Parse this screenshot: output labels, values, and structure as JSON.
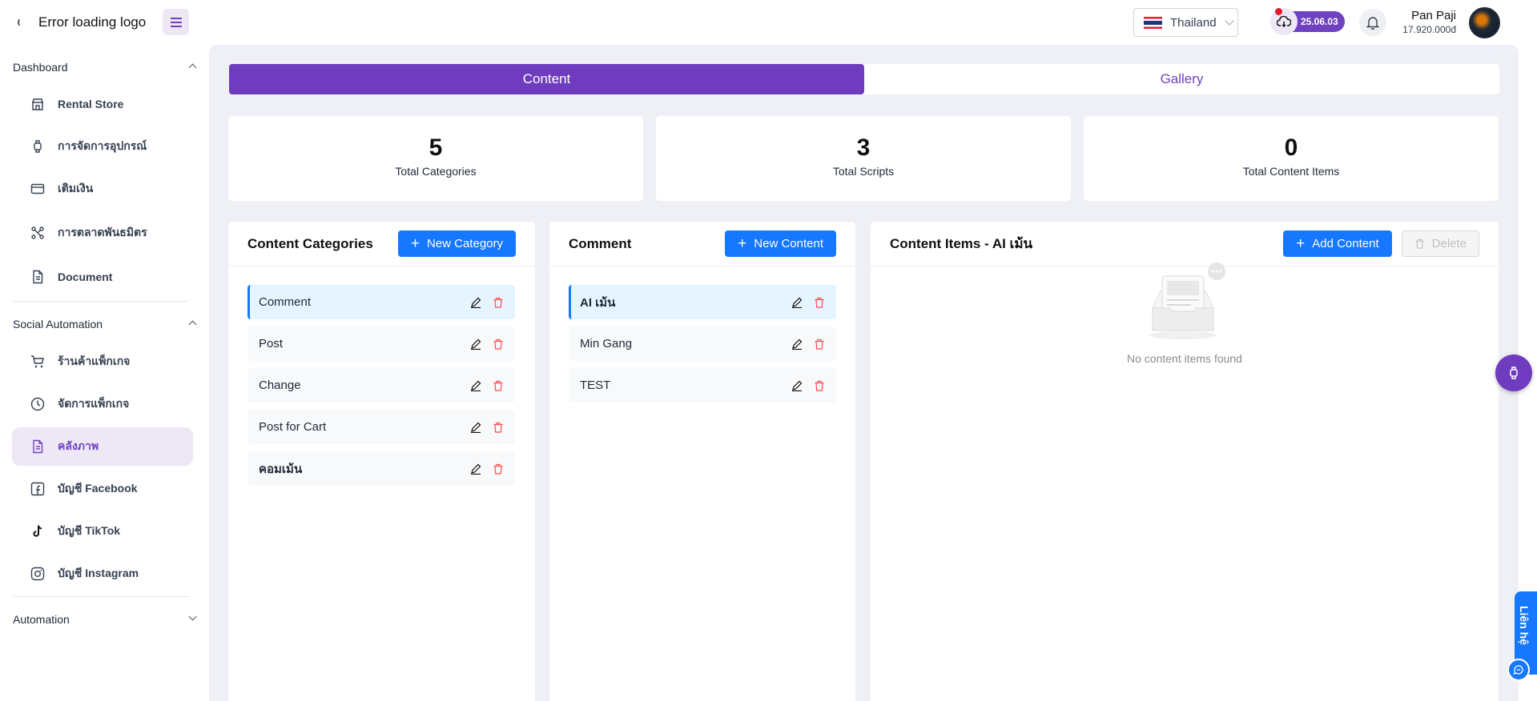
{
  "header": {
    "logo_text": "Error loading logo",
    "country": "Thailand",
    "version": "25.06.03",
    "user_name": "Pan Paji",
    "user_balance": "17.920.000đ"
  },
  "sidebar": {
    "sections": [
      {
        "label": "Dashboard"
      },
      {
        "label": "Social Automation"
      },
      {
        "label": "Automation"
      }
    ],
    "items": [
      {
        "label": "Rental Store",
        "icon": "store-icon"
      },
      {
        "label": "การจัดการอุปกรณ์",
        "icon": "watch-icon"
      },
      {
        "label": "เติมเงิน",
        "icon": "card-icon"
      },
      {
        "label": "การตลาดพันธมิตร",
        "icon": "network-icon"
      },
      {
        "label": "Document",
        "icon": "document-icon"
      },
      {
        "label": "ร้านค้าแพ็กเกจ",
        "icon": "cart-icon"
      },
      {
        "label": "จัดการแพ็กเกจ",
        "icon": "clock-icon"
      },
      {
        "label": "คลังภาพ",
        "icon": "file-icon"
      },
      {
        "label": "บัญชี Facebook",
        "icon": "facebook-icon"
      },
      {
        "label": "บัญชี TikTok",
        "icon": "tiktok-icon"
      },
      {
        "label": "บัญชี Instagram",
        "icon": "instagram-icon"
      }
    ]
  },
  "tabs": [
    {
      "label": "Content"
    },
    {
      "label": "Gallery"
    }
  ],
  "stats": [
    {
      "value": "5",
      "label": "Total Categories"
    },
    {
      "value": "3",
      "label": "Total Scripts"
    },
    {
      "value": "0",
      "label": "Total Content Items"
    }
  ],
  "categories": {
    "title": "Content Categories",
    "new_label": "New Category",
    "items": [
      "Comment",
      "Post",
      "Change",
      "Post for Cart",
      "คอมเม้น"
    ]
  },
  "scripts": {
    "title": "Comment",
    "new_label": "New Content",
    "items": [
      "AI เม้น",
      "Min Gang",
      "TEST"
    ]
  },
  "content_items": {
    "title": "Content Items - AI เม้น",
    "add_label": "Add Content",
    "delete_label": "Delete",
    "empty_text": "No content items found"
  },
  "contact_label": "Liên hệ",
  "colors": {
    "accent": "#6f3bbf",
    "primary_button": "#1677ff",
    "delete_icon": "#ff4d4f"
  }
}
